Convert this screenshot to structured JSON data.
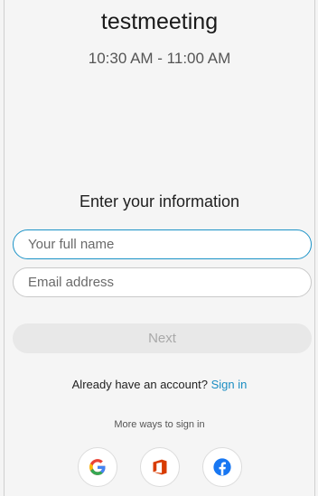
{
  "meeting": {
    "title": "testmeeting",
    "time": "10:30 AM - 11:00 AM"
  },
  "form": {
    "heading": "Enter your information",
    "name_placeholder": "Your full name",
    "email_placeholder": "Email address",
    "next_label": "Next"
  },
  "account": {
    "prompt": "Already have an account?",
    "sign_in_label": "Sign in"
  },
  "social": {
    "label": "More ways to sign in",
    "providers": [
      {
        "name": "google",
        "icon": "google-icon",
        "color": "#4285F4"
      },
      {
        "name": "office",
        "icon": "office-icon",
        "color": "#D83B01"
      },
      {
        "name": "facebook",
        "icon": "facebook-icon",
        "color": "#1877F2"
      }
    ]
  },
  "colors": {
    "accent": "#1a8dc2",
    "focus_border": "#1c93c7"
  }
}
